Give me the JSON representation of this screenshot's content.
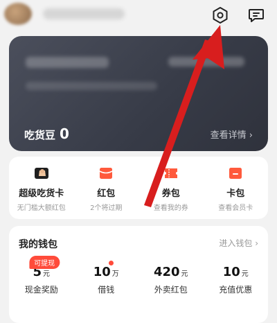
{
  "icons": {
    "settings": "gear-hexagon",
    "message": "chat-bubble",
    "super_card": "card-character",
    "red_packet": "red-envelope",
    "coupon": "ticket",
    "card": "member-card"
  },
  "colors": {
    "accent": "#ff4b3a",
    "card_dark": "#3b3f4b",
    "annotation_arrow": "#d81e1e"
  },
  "member_card": {
    "beans_label": "吃货豆",
    "beans_value": "0",
    "details_link": "查看详情"
  },
  "shortcuts": [
    {
      "title": "超级吃货卡",
      "subtitle": "无门槛大额红包"
    },
    {
      "title": "红包",
      "subtitle": "2个将过期"
    },
    {
      "title": "券包",
      "subtitle": "查看我的券"
    },
    {
      "title": "卡包",
      "subtitle": "查看会员卡"
    }
  ],
  "wallet": {
    "title": "我的钱包",
    "link": "进入钱包",
    "items": [
      {
        "value": "5",
        "unit": "元",
        "label": "现金奖励",
        "badge": "可提现"
      },
      {
        "value": "10",
        "unit": "万",
        "label": "借钱"
      },
      {
        "value": "420",
        "unit": "元",
        "label": "外卖红包"
      },
      {
        "value": "10",
        "unit": "元",
        "label": "充值优惠"
      }
    ]
  }
}
